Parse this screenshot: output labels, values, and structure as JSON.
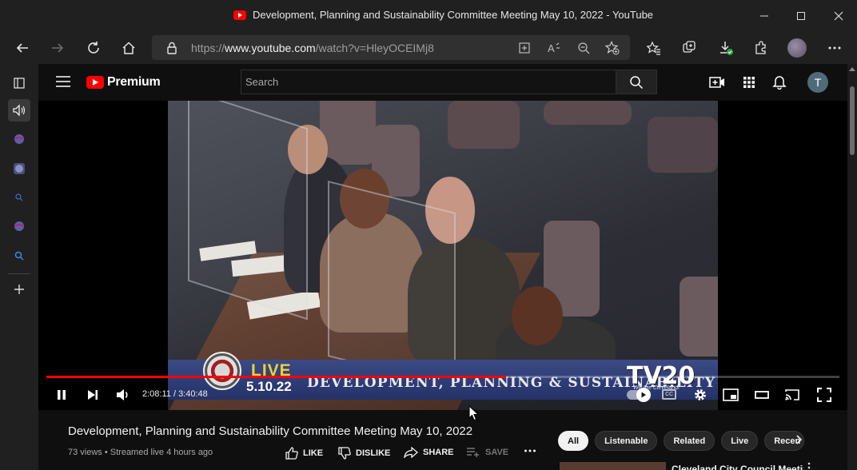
{
  "browser": {
    "window_title": "Development, Planning and Sustainability Committee Meeting May 10, 2022 - YouTube",
    "url_prefix": "https://",
    "url_host": "www.youtube.com",
    "url_path": "/watch?v=HleyOCEIMj8"
  },
  "youtube": {
    "logo_text": "Premium",
    "search_placeholder": "Search",
    "avatar_initial": "T"
  },
  "player": {
    "current_time": "2:08:11",
    "duration": "3:40:48",
    "time_separator": " / ",
    "progress_fraction": 0.58,
    "overlay": {
      "live_label": "LIVE",
      "date": "5.10.22",
      "committee": "DEVELOPMENT, PLANNING & SUSTAINABILITY",
      "station": "TV20",
      "station_tagline": "We Are Cleveland!",
      "cc_label": "CC"
    }
  },
  "video": {
    "title": "Development, Planning and Sustainability Committee Meeting May 10, 2022",
    "views": "73 views",
    "separator": " • ",
    "streamed": "Streamed live 4 hours ago",
    "actions": {
      "like": "LIKE",
      "dislike": "DISLIKE",
      "share": "SHARE",
      "save": "SAVE"
    }
  },
  "chips": [
    "All",
    "Listenable",
    "Related",
    "Live",
    "Recen"
  ],
  "related": {
    "first_title": "Cleveland City Council Meeting"
  },
  "colors": {
    "youtube_red": "#ff0000",
    "background": "#0f0f0f",
    "chrome": "#202020"
  }
}
